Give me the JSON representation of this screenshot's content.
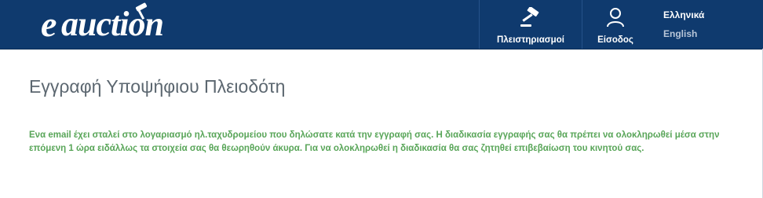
{
  "header": {
    "logo": {
      "prefix": "e",
      "word": "auction",
      "icon": "gavel-icon"
    },
    "nav": [
      {
        "label": "Πλειστηριασμοί",
        "icon": "gavel-icon"
      },
      {
        "label": "Είσοδος",
        "icon": "user-icon"
      }
    ],
    "languages": [
      {
        "label": "Ελληνικά",
        "active": true
      },
      {
        "label": "English",
        "active": false
      }
    ]
  },
  "main": {
    "title": "Εγγραφή Υποψήφιου Πλειοδότη",
    "notice": "Ενα email έχει σταλεί στο λογαριασμό ηλ.ταχυδρομείου που δηλώσατε κατά την εγγραφή σας. Η διαδικασία εγγραφής σας θα πρέπει να ολοκληρωθεί μέσα στην επόμενη 1 ώρα ειδάλλως τα στοιχεία σας θα θεωρηθούν άκυρα. Για να ολοκληρωθεί η διαδικασία θα σας ζητηθεί επιβεβαίωση του κινητού σας."
  },
  "colors": {
    "header_bg": "#0f3a6e",
    "title": "#5c6770",
    "notice": "#58a558",
    "lang_inactive": "#b8c6d8"
  }
}
